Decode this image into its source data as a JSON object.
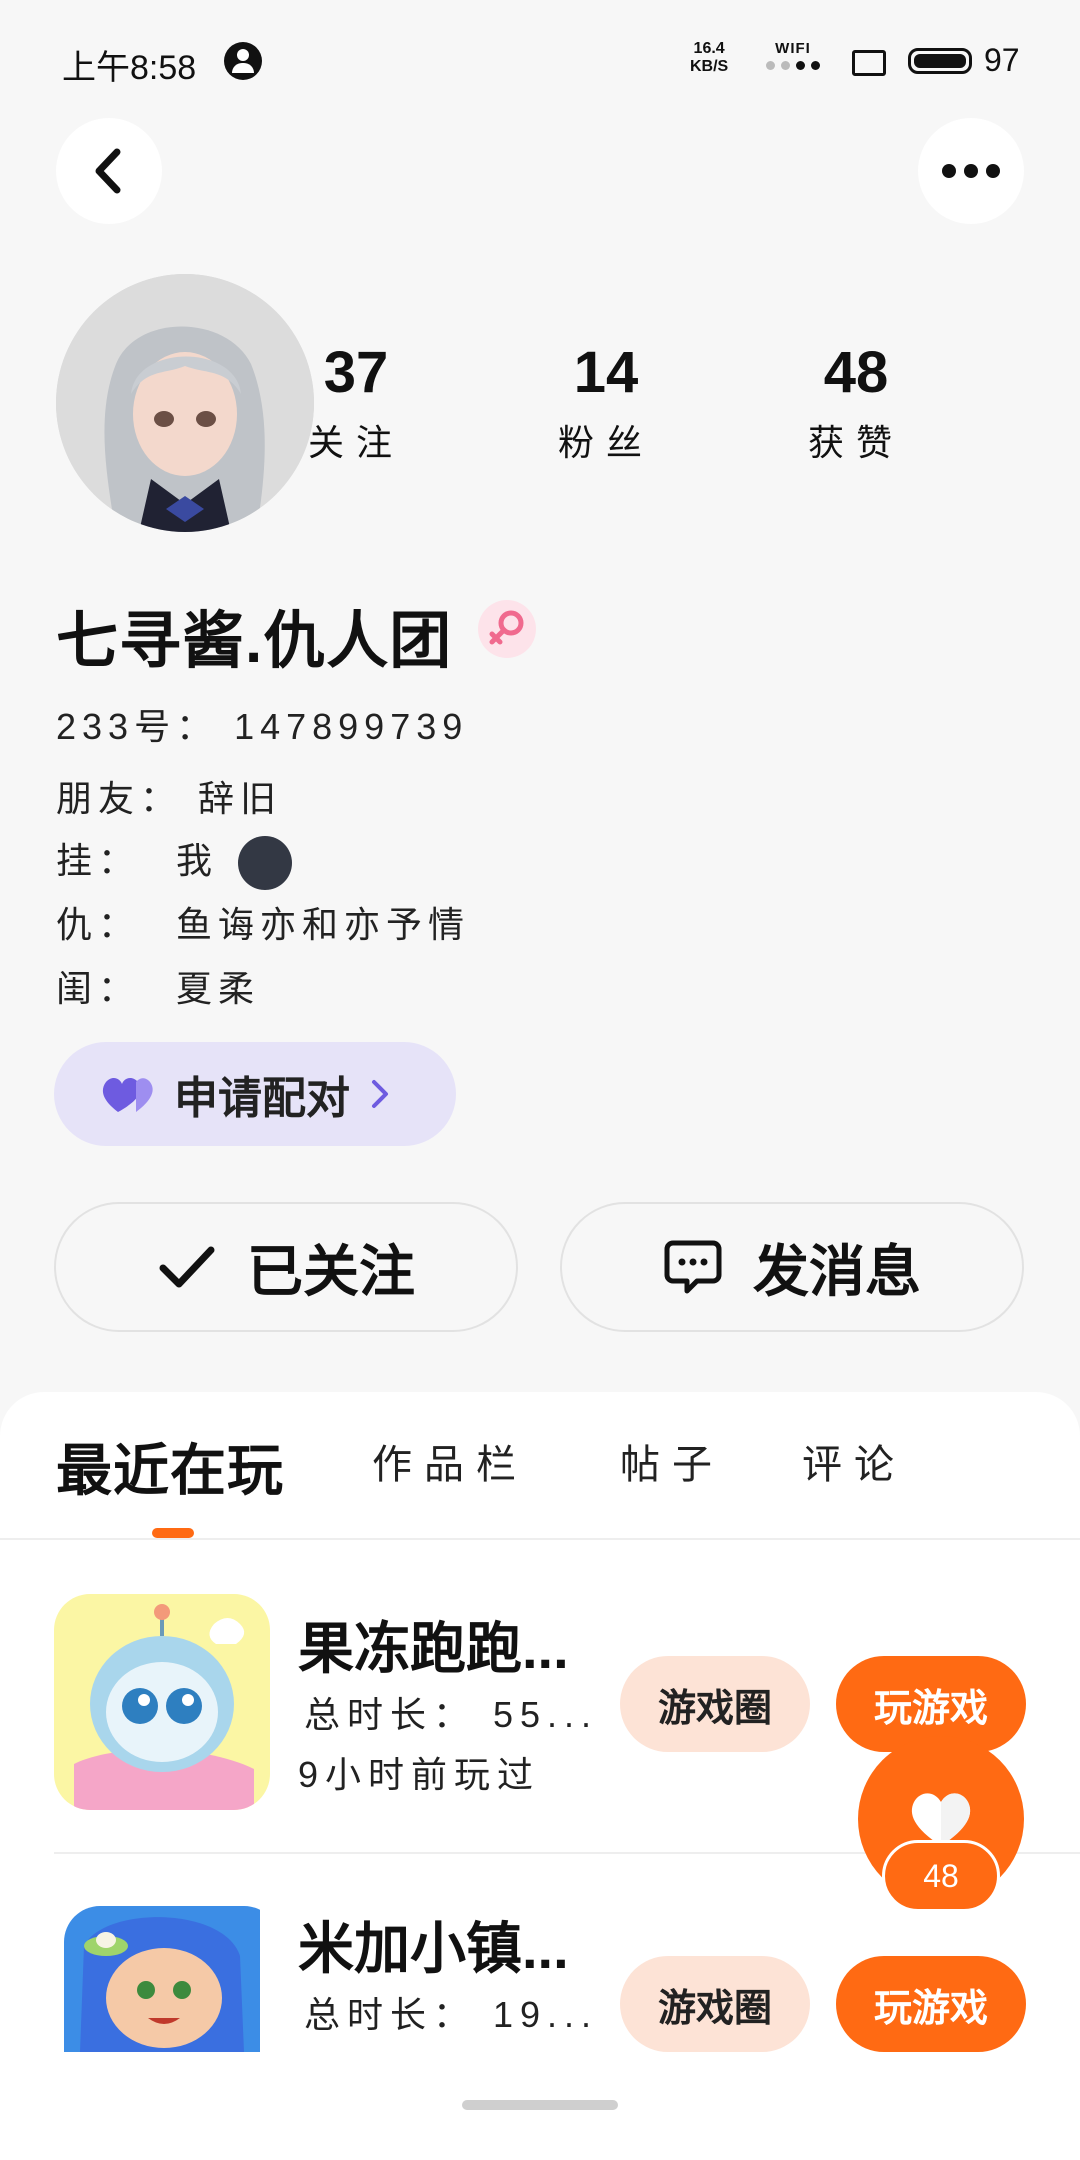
{
  "status_bar": {
    "time": "上午8:58",
    "net_speed_value": "16.4",
    "net_speed_unit": "KB/S",
    "wifi_label": "WIFI",
    "battery": "97"
  },
  "profile": {
    "stats": [
      {
        "num": "37",
        "label": "关注"
      },
      {
        "num": "14",
        "label": "粉丝"
      },
      {
        "num": "48",
        "label": "获赞"
      }
    ],
    "name": "七寻酱.仇人团",
    "id_line": "233号：  147899739",
    "info_lines": [
      {
        "key": "朋友：",
        "value": "辞旧"
      },
      {
        "key": "挂：",
        "value": "我"
      },
      {
        "key": "仇：",
        "value": "鱼诲亦和亦予情"
      },
      {
        "key": "闺：",
        "value": "夏柔"
      }
    ],
    "moon_emoji": "🌚",
    "pair_label": "申请配对",
    "follow_label": "已关注",
    "message_label": "发消息"
  },
  "tabs": [
    "最近在玩",
    "作品栏",
    "帖子",
    "评论"
  ],
  "games": [
    {
      "title": "果冻跑跑...",
      "duration": "总时长：  55...",
      "last_played": "9小时前玩过",
      "circle_label": "游戏圈",
      "play_label": "玩游戏"
    },
    {
      "title": "米加小镇...",
      "duration": "总时长：  19...",
      "circle_label": "游戏圈",
      "play_label": "玩游戏"
    }
  ],
  "like_count": "48",
  "colors": {
    "accent": "#ff6a13",
    "pair_bg": "#e6e3f8",
    "pill_bg": "#fde3d6"
  }
}
